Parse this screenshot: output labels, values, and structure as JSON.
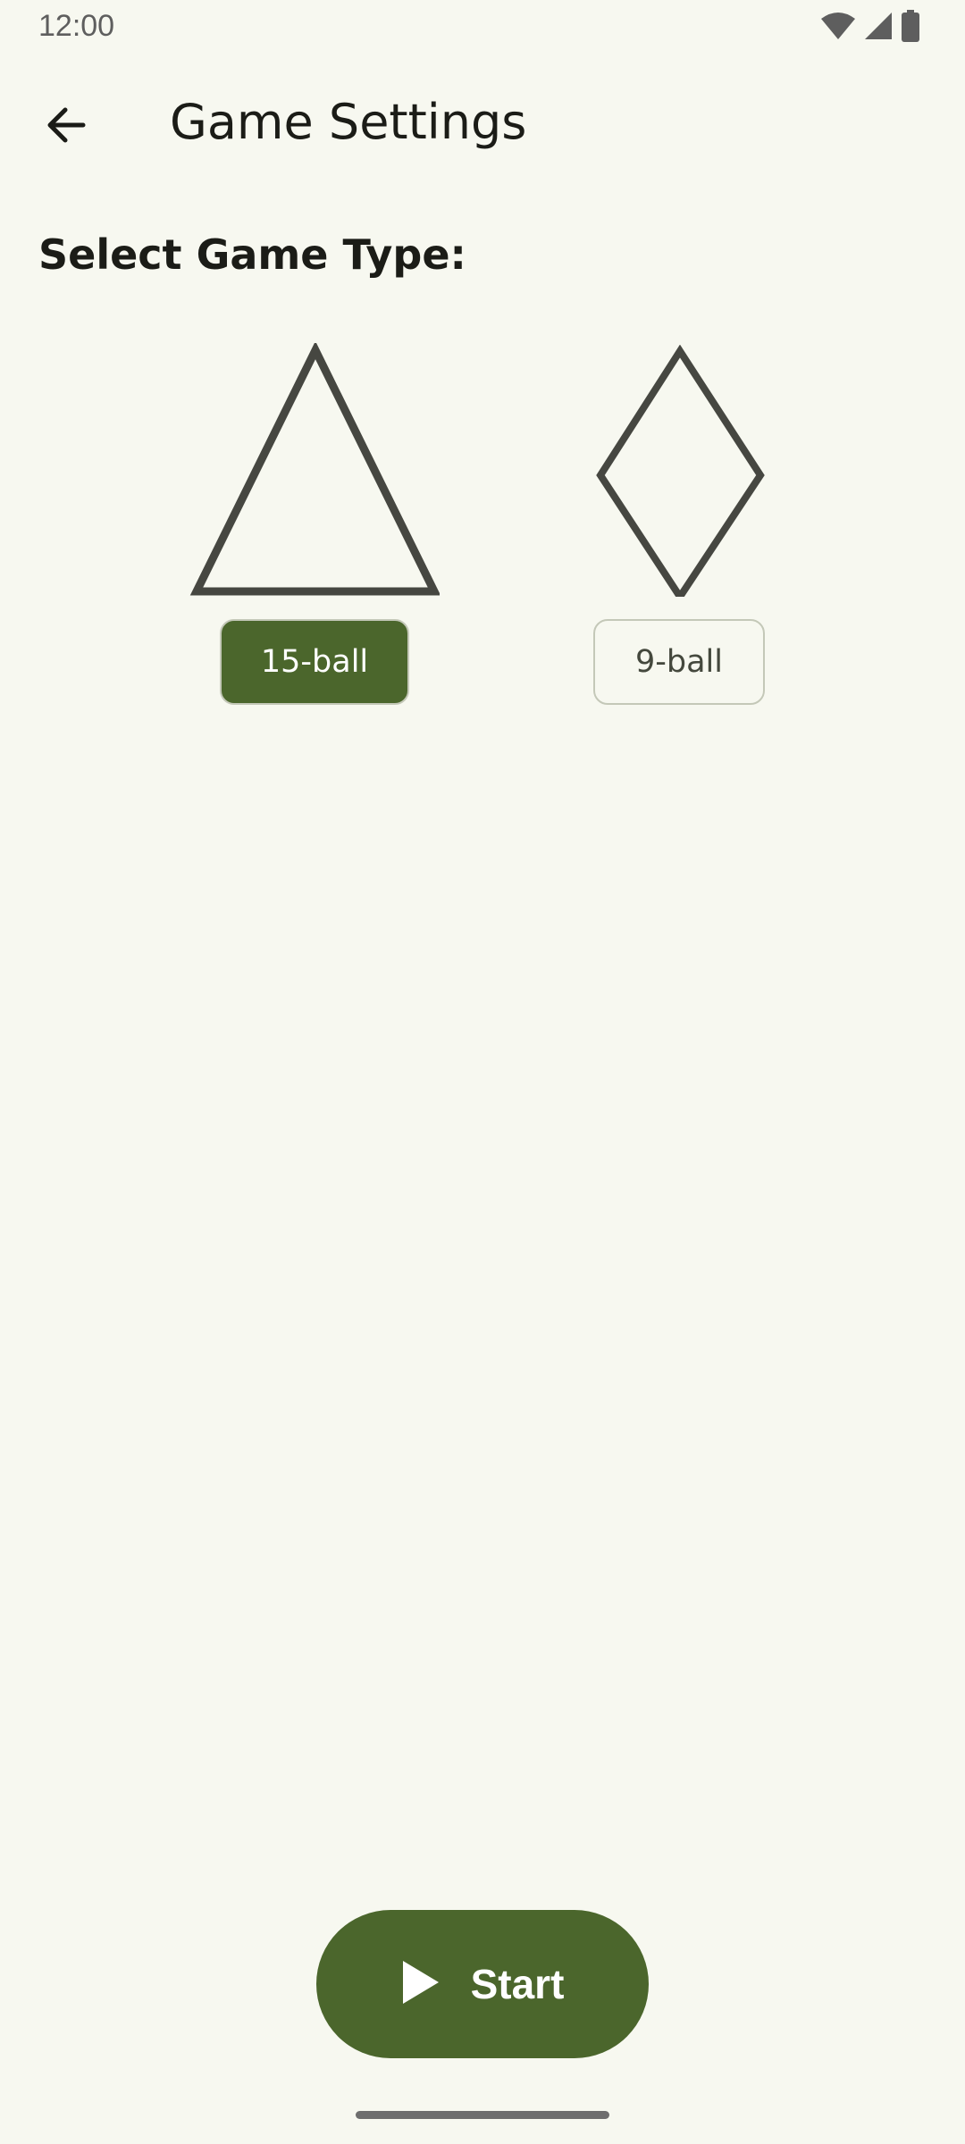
{
  "status_bar": {
    "time": "12:00",
    "icons": [
      "wifi-icon",
      "cellular-signal-icon",
      "battery-icon"
    ]
  },
  "app_bar": {
    "back_icon": "arrow-back-icon",
    "title": "Game Settings"
  },
  "section": {
    "label": "Select Game Type:"
  },
  "game_types": [
    {
      "label": "15-ball",
      "shape": "triangle",
      "selected": true
    },
    {
      "label": "9-ball",
      "shape": "diamond",
      "selected": false
    }
  ],
  "start_button": {
    "icon": "play-icon",
    "label": "Start"
  },
  "colors": {
    "background": "#f7f8f0",
    "primary": "#4b662c",
    "on_primary": "#ffffff",
    "outline": "#c4c8b8",
    "shape_stroke": "#464741"
  }
}
